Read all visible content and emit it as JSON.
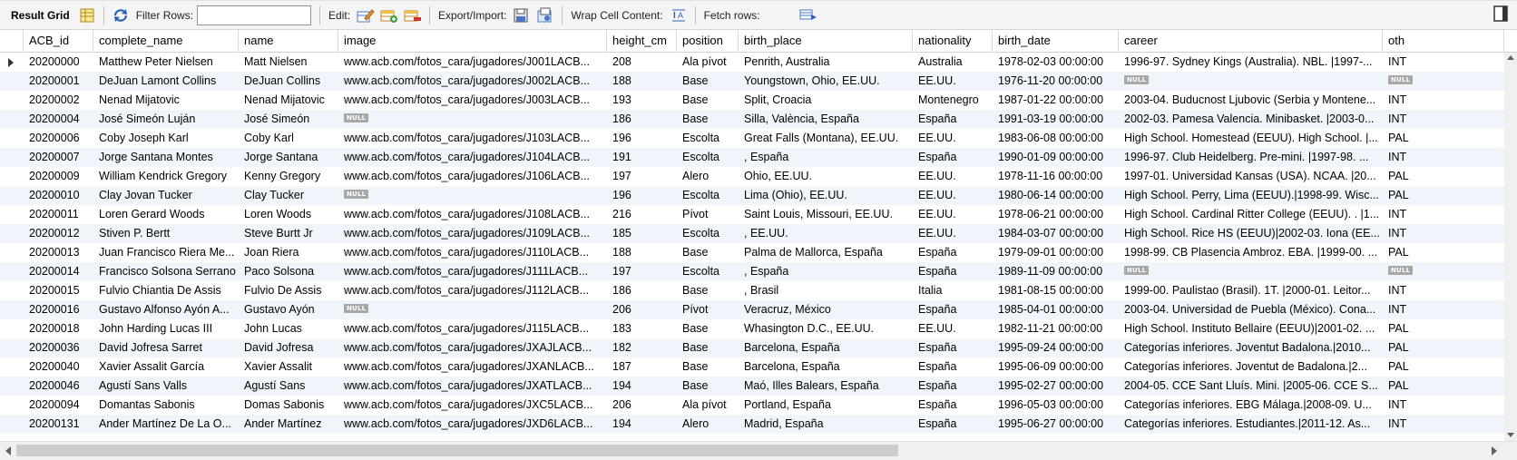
{
  "toolbar": {
    "result_grid": "Result Grid",
    "filter_rows": "Filter Rows:",
    "filter_value": "",
    "edit": "Edit:",
    "export_import": "Export/Import:",
    "wrap_cell": "Wrap Cell Content:",
    "fetch_rows": "Fetch rows:"
  },
  "null_label": "NULL",
  "columns": [
    "ACB_id",
    "complete_name",
    "name",
    "image",
    "height_cm",
    "position",
    "birth_place",
    "nationality",
    "birth_date",
    "career",
    "oth"
  ],
  "rows": [
    [
      "20200000",
      "Matthew Peter Nielsen",
      "Matt Nielsen",
      "www.acb.com/fotos_cara/jugadores/J001LACB...",
      "208",
      "Ala pívot",
      "Penrith, Australia",
      "Australia",
      "1978-02-03 00:00:00",
      "1996-97. Sydney Kings (Australia). NBL. |1997-...",
      "INT"
    ],
    [
      "20200001",
      "DeJuan Lamont Collins",
      "DeJuan Collins",
      "www.acb.com/fotos_cara/jugadores/J002LACB...",
      "188",
      "Base",
      "Youngstown, Ohio, EE.UU.",
      "EE.UU.",
      "1976-11-20 00:00:00",
      null,
      null
    ],
    [
      "20200002",
      "Nenad Mijatovic",
      "Nenad Mijatovic",
      "www.acb.com/fotos_cara/jugadores/J003LACB...",
      "193",
      "Base",
      "Split, Croacia",
      "Montenegro",
      "1987-01-22 00:00:00",
      "2003-04. Buducnost Ljubovic (Serbia y Montene...",
      "INT"
    ],
    [
      "20200004",
      "José Simeón Luján",
      "José Simeón",
      null,
      "186",
      "Base",
      "Silla, València, España",
      "España",
      "1991-03-19 00:00:00",
      "2002-03. Pamesa Valencia. Minibasket. |2003-0...",
      "INT"
    ],
    [
      "20200006",
      "Coby Joseph Karl",
      "Coby Karl",
      "www.acb.com/fotos_cara/jugadores/J103LACB...",
      "196",
      "Escolta",
      "Great Falls (Montana), EE.UU.",
      "EE.UU.",
      "1983-06-08 00:00:00",
      "High School. Homestead (EEUU). High School. |...",
      "PAL"
    ],
    [
      "20200007",
      "Jorge Santana Montes",
      "Jorge Santana",
      "www.acb.com/fotos_cara/jugadores/J104LACB...",
      "191",
      "Escolta",
      ", España",
      "España",
      "1990-01-09 00:00:00",
      "1996-97. Club Heidelberg. Pre-mini. |1997-98. ...",
      "INT"
    ],
    [
      "20200009",
      "William Kendrick Gregory",
      "Kenny Gregory",
      "www.acb.com/fotos_cara/jugadores/J106LACB...",
      "197",
      "Alero",
      "Ohio, EE.UU.",
      "EE.UU.",
      "1978-11-16 00:00:00",
      "1997-01. Universidad Kansas (USA). NCAA. |20...",
      "PAL"
    ],
    [
      "20200010",
      "Clay Jovan Tucker",
      "Clay Tucker",
      null,
      "196",
      "Escolta",
      "Lima (Ohio), EE.UU.",
      "EE.UU.",
      "1980-06-14 00:00:00",
      "High School. Perry, Lima (EEUU).|1998-99. Wisc...",
      "PAL"
    ],
    [
      "20200011",
      "Loren Gerard Woods",
      "Loren Woods",
      "www.acb.com/fotos_cara/jugadores/J108LACB...",
      "216",
      "Pívot",
      "Saint Louis, Missouri, EE.UU.",
      "EE.UU.",
      "1978-06-21 00:00:00",
      "High School. Cardinal Ritter College (EEUU). . |1...",
      "INT"
    ],
    [
      "20200012",
      "Stiven P. Bertt",
      "Steve Burtt Jr",
      "www.acb.com/fotos_cara/jugadores/J109LACB...",
      "185",
      "Escolta",
      ", EE.UU.",
      "EE.UU.",
      "1984-03-07 00:00:00",
      "High School. Rice HS (EEUU)|2002-03. Iona (EE...",
      "INT"
    ],
    [
      "20200013",
      "Juan Francisco Riera Me...",
      "Joan Riera",
      "www.acb.com/fotos_cara/jugadores/J110LACB...",
      "188",
      "Base",
      "Palma de Mallorca, España",
      "España",
      "1979-09-01 00:00:00",
      "1998-99. CB Plasencia Ambroz. EBA. |1999-00. ...",
      "PAL"
    ],
    [
      "20200014",
      "Francisco Solsona Serrano",
      "Paco Solsona",
      "www.acb.com/fotos_cara/jugadores/J111LACB...",
      "197",
      "Escolta",
      ", España",
      "España",
      "1989-11-09 00:00:00",
      null,
      null
    ],
    [
      "20200015",
      "Fulvio Chiantia De Assis",
      "Fulvio De Assis",
      "www.acb.com/fotos_cara/jugadores/J112LACB...",
      "186",
      "Base",
      ", Brasil",
      "Italia",
      "1981-08-15 00:00:00",
      "1999-00. Paulistao (Brasil). 1T. |2000-01. Leitor...",
      "INT"
    ],
    [
      "20200016",
      "Gustavo Alfonso Ayón A...",
      "Gustavo Ayón",
      null,
      "206",
      "Pívot",
      "Veracruz, México",
      "España",
      "1985-04-01 00:00:00",
      "2003-04. Universidad de Puebla (México). Cona...",
      "INT"
    ],
    [
      "20200018",
      "John Harding Lucas III",
      "John Lucas",
      "www.acb.com/fotos_cara/jugadores/J115LACB...",
      "183",
      "Base",
      "Whasington D.C., EE.UU.",
      "EE.UU.",
      "1982-11-21 00:00:00",
      "High School. Instituto Bellaire (EEUU)|2001-02. ...",
      "PAL"
    ],
    [
      "20200036",
      "David Jofresa Sarret",
      "David Jofresa",
      "www.acb.com/fotos_cara/jugadores/JXAJLACB...",
      "182",
      "Base",
      "Barcelona, España",
      "España",
      "1995-09-24 00:00:00",
      "Categorías inferiores. Joventut Badalona.|2010...",
      "PAL"
    ],
    [
      "20200040",
      "Xavier Assalit García",
      "Xavier Assalit",
      "www.acb.com/fotos_cara/jugadores/JXANLACB...",
      "187",
      "Base",
      "Barcelona, España",
      "España",
      "1995-06-09 00:00:00",
      "Categorías inferiores. Joventut de Badalona.|2...",
      "PAL"
    ],
    [
      "20200046",
      "Agustí Sans Valls",
      "Agustí Sans",
      "www.acb.com/fotos_cara/jugadores/JXATLACB...",
      "194",
      "Base",
      "Maó, Illes Balears, España",
      "España",
      "1995-02-27 00:00:00",
      "2004-05. CCE Sant Lluís. Mini. |2005-06. CCE S...",
      "PAL"
    ],
    [
      "20200094",
      "Domantas Sabonis",
      "Domas Sabonis",
      "www.acb.com/fotos_cara/jugadores/JXC5LACB...",
      "206",
      "Ala pívot",
      "Portland, España",
      "España",
      "1996-05-03 00:00:00",
      "Categorías inferiores. EBG Málaga.|2008-09. U...",
      "INT"
    ],
    [
      "20200131",
      "Ander Martínez De La O...",
      "Ander Martínez",
      "www.acb.com/fotos_cara/jugadores/JXD6LACB...",
      "194",
      "Alero",
      "Madrid, España",
      "España",
      "1995-06-27 00:00:00",
      "Categorías inferiores. Estudiantes.|2011-12. As...",
      "INT"
    ]
  ],
  "colors": {
    "alt_row": "#f0f4fb",
    "null_badge": "#a8a8a8",
    "toolbar_bg": "#f4f4f4"
  }
}
